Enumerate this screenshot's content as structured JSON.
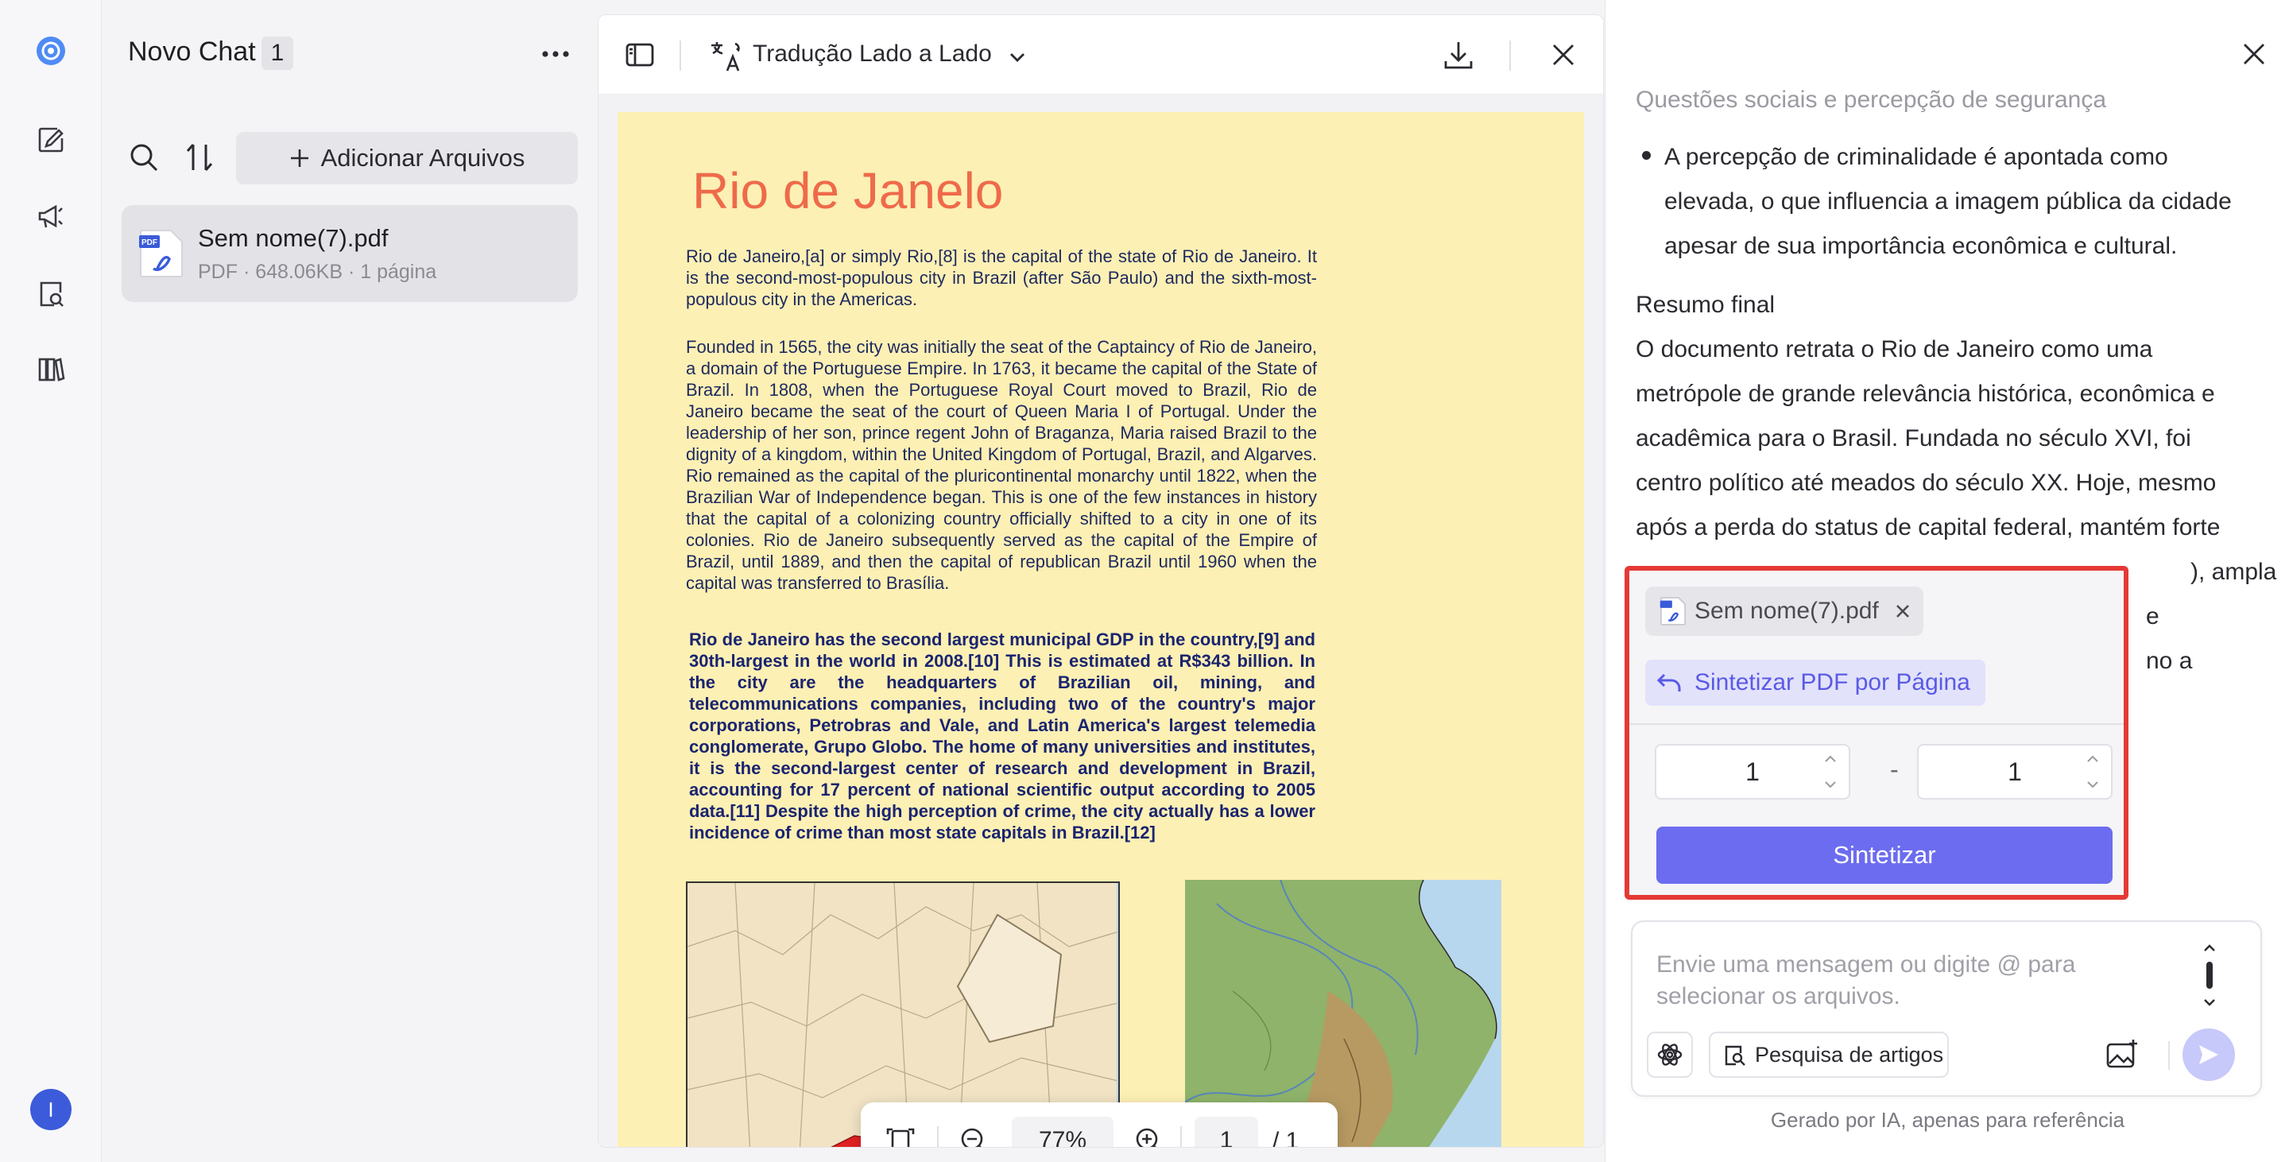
{
  "rail": {
    "icons": [
      "app-logo-icon",
      "edit-icon",
      "megaphone-icon",
      "search-document-icon",
      "library-icon"
    ],
    "avatar_letter": "I"
  },
  "files_panel": {
    "title": "Novo Chat",
    "count": "1",
    "add_files_label": "Adicionar Arquivos",
    "file": {
      "name": "Sem nome(7).pdf",
      "meta": "PDF · 648.06KB · 1 página",
      "icon_badge": "PDF"
    }
  },
  "viewer": {
    "translate_label": "Tradução Lado a Lado",
    "zoom": "77%",
    "page_current": "1",
    "page_total": "/ 1",
    "pdf": {
      "title": "Rio de Janelo",
      "p1": "Rio de Janeiro,[a] or simply Rio,[8] is the capital of the state of Rio de Janeiro. It is the second-most-populous city in Brazil (after São Paulo) and the sixth-most-populous city in the Americas.",
      "p2": "Founded in 1565, the city was initially the seat of the Captaincy of Rio de Janeiro, a domain of the Portuguese Empire. In 1763, it became the capital of the State of Brazil. In 1808, when the Portuguese Royal Court moved to Brazil, Rio de Janeiro became the seat of the court of Queen Maria I of Portugal. Under the leadership of her son, prince regent John of Braganza, Maria raised Brazil to the dignity of a kingdom, within the United Kingdom of Portugal, Brazil, and Algarves. Rio remained as the capital of the pluricontinental monarchy until 1822, when the Brazilian War of Independence began. This is one of the few instances in history that the capital of a colonizing country officially shifted to a city in one of its colonies. Rio de Janeiro subsequently served as the capital of the Empire of Brazil, until 1889, and then the capital of republican Brazil until 1960 when the capital was transferred to Brasília.",
      "p3": "Rio de Janeiro has the second largest municipal GDP in the country,[9] and 30th-largest in the world in 2008.[10] This is estimated at R$343 billion. In the city are the headquarters of Brazilian oil, mining, and telecommunications companies, including two of the country's major corporations, Petrobras and Vale, and Latin America's largest telemedia conglomerate, Grupo Globo. The home of many universities and institutes, it is the second-largest center of research and development in Brazil, accounting for 17 percent of national scientific output according to 2005 data.[11] Despite the high perception of crime, the city actually has a lower incidence of crime than most state capitals in Brazil.[12]"
    }
  },
  "chat": {
    "faded_heading": "Questões sociais e percepção de segurança",
    "bullet": "A percepção de criminalidade é apontada como elevada, o que influencia a imagem pública da cidade apesar de sua importância econômica e cultural.",
    "summary_heading": "Resumo final",
    "summary_text": "O documento retrata o Rio de Janeiro como uma metrópole de grande relevância histórica, econômica e acadêmica para o Brasil. Fundada no século XVI, foi centro político até meados do século XX. Hoje, mesmo após a perda do status de capital federal, mantém forte",
    "hidden_fragment_1": "), ampla",
    "hidden_fragment_2": "e",
    "hidden_fragment_3": "no a",
    "popup": {
      "file_chip": "Sem nome(7).pdf",
      "action_chip": "Sintetizar PDF por Página",
      "range_from": "1",
      "range_to": "1",
      "range_separator": "-",
      "submit_label": "Sintetizar",
      "border_color": "#e53935"
    },
    "composer": {
      "placeholder": "Envie uma mensagem ou digite @ para selecionar os arquivos.",
      "research_label": "Pesquisa de artigos"
    },
    "disclaimer": "Gerado por IA, apenas para referência"
  },
  "colors": {
    "accent": "#6c6cf0",
    "pdf_background": "#fdf0b4",
    "pdf_title": "#ee6a4a"
  }
}
